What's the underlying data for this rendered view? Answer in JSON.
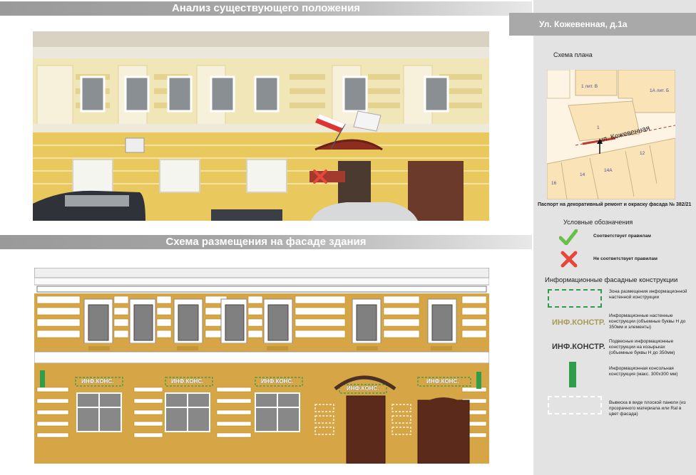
{
  "header": {
    "existing_title": "Анализ существующего положения",
    "scheme_title": "Схема размещения на фасаде здания",
    "address": "Ул. Кожевенная, д.1а"
  },
  "plan": {
    "label": "Схема плана",
    "map_labels": {
      "building_1": "1 лит. В",
      "building_2": "1А лит. Б",
      "building_3": "1",
      "street": "ул. Кожевенная",
      "lot_12": "12",
      "lot_14": "14",
      "lot_14a": "14А",
      "lot_16": "16"
    },
    "passport": "Паспорт на декоративный ремонт и окраску фасада № 382/21"
  },
  "legend": {
    "title": "Условные обозначения",
    "ok_label": "Соответствует правилам",
    "bad_label": "Не соответствует правилам",
    "info_title": "Информационные фасадные конструкции",
    "zone_label": "Зона размещения информационной настенной конструкции",
    "wall_sample": "ИНФ.КОНСТР.",
    "wall_label": "Информационные настенные конструкции (объемные буквы Н до 350мм и элементы)",
    "canopy_sample": "ИНФ.КОНСТР.",
    "canopy_label": "Подвесные информационные конструкции на козырьках (объемные буквы Н до 350мм)",
    "console_label": "Информационная консольная конструкция (макс. 300х300 мм)",
    "panel_label": "Вывеска в виде плоской панели (из прозрачного материала или Ral в цвет фасада)"
  },
  "facade": {
    "sign_text": "ИНФ.КОНС.",
    "canopy_sign_text": "ИНФ.КОНС."
  },
  "colors": {
    "accent_red": "#c0392b",
    "ok_green": "#6abf4b",
    "bad_red": "#e8463a",
    "facade_yellow": "#d6a545",
    "console_green": "#2e9e4b"
  }
}
